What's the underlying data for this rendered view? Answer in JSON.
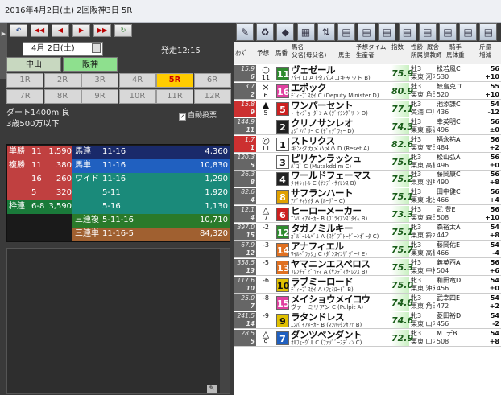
{
  "window": {
    "title": "2016年4月2日(土) 2回阪神3日 5R"
  },
  "nav": {
    "buttons": [
      "↶",
      "◀◀",
      "◀",
      "▶",
      "▶▶",
      "↻"
    ]
  },
  "date": {
    "value": "4月 2日(土)"
  },
  "post_time": "発走12:15",
  "venues": [
    {
      "label": "中山",
      "bg": "#c8d8c0",
      "color": "#222"
    },
    {
      "label": "阪神",
      "bg": "#8ee08e",
      "color": "#111"
    }
  ],
  "races": [
    "1R",
    "2R",
    "3R",
    "4R",
    "5R",
    "6R",
    "7R",
    "8R",
    "9R",
    "10R",
    "11R",
    "12R"
  ],
  "selected_race": "5R",
  "race_info": {
    "course": "ダート1400m 良",
    "class": "3歳500万以下"
  },
  "auto_vote": {
    "label": "自動投票",
    "checked": "✓"
  },
  "odds_table": [
    {
      "bet": "単勝",
      "a": "11",
      "b": "",
      "val": "1,590",
      "bet2": "馬連",
      "combo": "11-16",
      "val2": "4,360",
      "bg1": "#c04040",
      "bg2": "#1a2a6a"
    },
    {
      "bet": "複勝",
      "a": "11",
      "b": "",
      "val": "380",
      "bet2": "馬単",
      "combo": "11-16",
      "val2": "10,830",
      "bg1": "#c04040",
      "bg2": "#2060c0"
    },
    {
      "bet": "",
      "a": "16",
      "b": "",
      "val": "260",
      "bet2": "ワイド",
      "combo": "11-16",
      "val2": "1,290",
      "bg1": "#c04040",
      "bg2": "#1a8a7a"
    },
    {
      "bet": "",
      "a": "5",
      "b": "",
      "val": "320",
      "bet2": "",
      "combo": "5-11",
      "val2": "1,920",
      "bg1": "#c04040",
      "bg2": "#1a8a7a"
    },
    {
      "bet": "枠連",
      "a": "6-8",
      "b": "",
      "val": "3,590",
      "bet2": "",
      "combo": "5-16",
      "val2": "1,130",
      "bg1": "#1a7a3a",
      "bg2": "#1a8a7a"
    },
    {
      "bet": "",
      "a": "",
      "b": "",
      "val": "",
      "bet2": "三連複",
      "combo": "5-11-16",
      "val2": "10,710",
      "bg1": "#1a1a1a",
      "bg2": "#2a7a2a"
    },
    {
      "bet": "",
      "a": "",
      "b": "",
      "val": "",
      "bet2": "三連単",
      "combo": "11-16-5",
      "val2": "84,320",
      "bg1": "#1a1a1a",
      "bg2": "#a06030"
    }
  ],
  "toolbar": [
    "✎",
    "♻",
    "◆",
    "▦",
    "⇅",
    "▤",
    "▤",
    "▤",
    "▤",
    "▤",
    "▤",
    "▤",
    "▤"
  ],
  "header": {
    "odds": "ｵｯｽﾞ",
    "pred": "予想",
    "num": "馬番",
    "name": "馬名",
    "parents": "父名(母父名)",
    "owner": "馬主",
    "breeder": "生産者",
    "pred_time": "予想タイム",
    "idx": "指数",
    "sex": "性齢",
    "belong": "所属",
    "stable": "厩舎",
    "trainer": "調教師",
    "jockey": "騎手",
    "horse_weight": "馬体重",
    "weight": "斤量",
    "diff": "増減"
  },
  "horses": [
    {
      "odds": "15.9",
      "pop": "6",
      "mark": "○",
      "mark2": "11",
      "num": "11",
      "num_bg": "#2e8b2e",
      "name": "ヴェゼール",
      "parents": "パイロ A (タバスコキャット B)",
      "idx": "75.9",
      "sex": "牡3",
      "trainer": "栗東 河内洋",
      "jockey": "松若風C",
      "hw": "530",
      "wt": "56",
      "diff": "+10",
      "odds_bg": "#666"
    },
    {
      "odds": "3.7",
      "pop": "2",
      "mark": "×",
      "mark2": "6",
      "num": "16",
      "num_bg": "#e040a0",
      "name": "エポック",
      "parents": "ﾃﾞｨｰﾌﾟｽｶｲ C (Deputy Minister D)",
      "idx": "80.9",
      "sex": "牡3",
      "trainer": "栗東 角田晃",
      "jockey": "鮫島克ユ",
      "hw": "520",
      "wt": "55",
      "diff": "+10",
      "odds_bg": "#666"
    },
    {
      "odds": "15.8",
      "pop": "9",
      "mark": "▲",
      "mark2": "5",
      "num": "5",
      "num_bg": "#cc2020",
      "name": "ワンパーセント",
      "parents": "ﾄｰｾﾝｼﾞｮｰﾀﾞﾝ A (ﾀﾞｲｼﾝｸﾞﾘｰﾝ D)",
      "idx": "77.1",
      "sex": "牝3",
      "trainer": "美浦 中川公",
      "jockey": "池添謙C",
      "hw": "436",
      "wt": "54",
      "diff": "-12",
      "odds_bg": "#cc3030"
    },
    {
      "odds": "144.9",
      "pop": "11",
      "mark": "",
      "mark2": "",
      "num": "2",
      "num_bg": "#222",
      "name": "クリノサンレオ",
      "parents": "ｶｼﾞﾉﾊﾟﾘｰ C (ﾃﾞｨｸﾞﾌｫｰ D)",
      "idx": "74.3",
      "sex": "牡3",
      "trainer": "栗東 藤沢則",
      "jockey": "幸英明C",
      "hw": "496",
      "wt": "56",
      "diff": "±0",
      "odds_bg": "#666"
    },
    {
      "odds": "1.7",
      "pop": "1",
      "mark": "◎",
      "mark2": "11",
      "num": "1",
      "num_bg": "#ffffff",
      "name": "ストリクス",
      "parents": "キングカメハメハ D (Reset A)",
      "idx": "82.6",
      "sex": "牡3",
      "trainer": "栗東 安田隆",
      "jockey": "福永祐A",
      "hw": "484",
      "wt": "56",
      "diff": "+2",
      "odds_bg": "#cc3030"
    },
    {
      "odds": "120.3",
      "pop": "5",
      "mark": "",
      "mark2": "",
      "num": "3",
      "num_bg": "#ffffff",
      "name": "ピリケンラッシュ",
      "parents": "ﾊﾞｺﾞ C (Mutakddim C)",
      "idx": "75.6",
      "sex": "牝3",
      "trainer": "栗東 高橋康",
      "jockey": "松山弘A",
      "hw": "496",
      "wt": "56",
      "diff": "±0",
      "odds_bg": "#666"
    },
    {
      "odds": "26.3",
      "pop": "8",
      "mark": "",
      "mark2": "",
      "num": "4",
      "num_bg": "#222",
      "name": "ワールドフェーマス",
      "parents": "ﾀｲｷｼｬﾄﾙ C (ｻﾝﾃﾞｨｻｲﾚﾝｽ B)",
      "idx": "75.2",
      "sex": "牡3",
      "trainer": "栗東 羽月友",
      "jockey": "藤岡康C",
      "hw": "490",
      "wt": "56",
      "diff": "+8",
      "odds_bg": "#666"
    },
    {
      "odds": "82.6",
      "pop": "4",
      "mark": "",
      "mark2": "",
      "num": "8",
      "num_bg": "#e0a000",
      "name": "サフランハート",
      "parents": "ｱﾊﾞﾃｨｹｲﾀ A (ﾙｰｻﾞｰ C)",
      "idx": "75.1",
      "sex": "牡3",
      "trainer": "栗東 北出成",
      "jockey": "田中健C",
      "hw": "466",
      "wt": "56",
      "diff": "+4",
      "odds_bg": "#666"
    },
    {
      "odds": "12.1",
      "pop": "4",
      "mark": "△",
      "mark2": "7",
      "num": "6",
      "num_bg": "#cc2020",
      "name": "ヒーローメーカー",
      "parents": "ｴﾝﾊﾟｲｱﾒｰｶｰ B (ﾌﾞﾗｲｱﾝｽﾞﾀｲﾑ B)",
      "idx": "73.3",
      "sex": "牡3",
      "trainer": "栗東 森田直",
      "jockey": "武 豊E",
      "hw": "508",
      "wt": "56",
      "diff": "+10",
      "odds_bg": "#666"
    },
    {
      "odds": "397.0",
      "pop": "15",
      "mark": "",
      "mark2": "-2",
      "num": "12",
      "num_bg": "#2e8b2e",
      "name": "タガノミルキー",
      "parents": "ｶﾞﾙﾞｰﾚﾑﾍﾞﾙ A (ｽｹﾞﾌﾟﾄｰｹﾞｰﾝｵﾞｰﾀ C)",
      "idx": "75.1",
      "sex": "牝3",
      "trainer": "栗東 鈴木孝",
      "jockey": "森裕太A",
      "hw": "442",
      "wt": "54",
      "diff": "+8",
      "odds_bg": "#666"
    },
    {
      "odds": "67.9",
      "pop": "12",
      "mark": "",
      "mark2": "-3",
      "num": "14",
      "num_bg": "#e07020",
      "name": "アナフィエル",
      "parents": "ﾜｲﾙﾄﾞﾗｯｼｭ C (ﾀﾞﾝｽｲﾝｻﾞﾀﾞｰｸ E)",
      "idx": "75.7",
      "sex": "牝3",
      "trainer": "栗東 高橋亮",
      "jockey": "藤岡佑E",
      "hw": "466",
      "wt": "54",
      "diff": "-4",
      "odds_bg": "#666"
    },
    {
      "odds": "358.5",
      "pop": "13",
      "mark": "",
      "mark2": "-5",
      "num": "13",
      "num_bg": "#e07020",
      "name": "ヤマニンエスペロス",
      "parents": "ﾌﾚﾝﾁﾃﾞﾋﾟｭﾃｨ A (ｻﾝﾃﾞｨｻｲﾚﾝｽ B)",
      "idx": "75.3",
      "sex": "牡3",
      "trainer": "栗東 中村均",
      "jockey": "義英西A",
      "hw": "504",
      "wt": "56",
      "diff": "+6",
      "odds_bg": "#666"
    },
    {
      "odds": "117.6",
      "pop": "10",
      "mark": "",
      "mark2": "-6",
      "num": "10",
      "num_bg": "#e0c000",
      "name": "ラブミーロード",
      "parents": "ﾃﾞｨｰﾌﾟｽｶｲ A (ﾌｪﾐﾛｰﾄﾞ B)",
      "idx": "75.0",
      "sex": "牝3",
      "trainer": "栗東 沖芳夫",
      "jockey": "和田竜D",
      "hw": "456",
      "wt": "54",
      "diff": "±0",
      "odds_bg": "#666"
    },
    {
      "odds": "25.0",
      "pop": "7",
      "mark": "",
      "mark2": "-8",
      "num": "15",
      "num_bg": "#e040a0",
      "name": "メイショウメイコウ",
      "parents": "ヴァーミリアン C (Pulpit A)",
      "idx": "74.8",
      "sex": "牝3",
      "trainer": "栗東 角田晃",
      "jockey": "武幸四E",
      "hw": "472",
      "wt": "54",
      "diff": "+2",
      "odds_bg": "#666"
    },
    {
      "odds": "241.5",
      "pop": "14",
      "mark": "",
      "mark2": "-9",
      "num": "9",
      "num_bg": "#e0c000",
      "name": "ラタンドレス",
      "parents": "ｴﾝﾊﾟｲｱﾒｰｶｰ B (ﾏﾝﾊｯﾀﾝｶﾌｪ B)",
      "idx": "74.6",
      "sex": "牝3",
      "trainer": "栗東 山内研",
      "jockey": "菱田裕D",
      "hw": "456",
      "wt": "54",
      "diff": "-2",
      "odds_bg": "#666"
    },
    {
      "odds": "28.5",
      "pop": "5",
      "mark": "△",
      "mark2": "9",
      "num": "7",
      "num_bg": "#2060c0",
      "name": "ダンツペンダント",
      "parents": "ｵﾙﾌｪｰｳﾞﾙ C (ﾌｧｿﾞﾞｰｽﾃﾞｨﾝ C)",
      "idx": "72.9",
      "sex": "牝3",
      "trainer": "栗東 山内研",
      "jockey": "M. デB",
      "hw": "508",
      "wt": "54",
      "diff": "+8",
      "odds_bg": "#666"
    }
  ]
}
